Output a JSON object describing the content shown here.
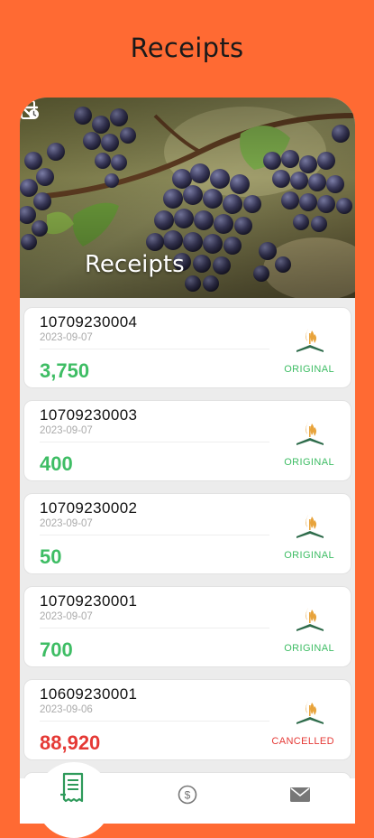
{
  "app": {
    "page_title": "Receipts",
    "accent_color": "#FF6A33",
    "original_color": "#3ebd64",
    "cancelled_color": "#e53935"
  },
  "header": {
    "title": "Receipts",
    "back_icon": "arrow-left-icon",
    "action_icon": "clipboard-clock-icon"
  },
  "receipts": [
    {
      "number": "10709230004",
      "date": "2023-09-07",
      "amount": "3,750",
      "status": "ORIGINAL"
    },
    {
      "number": "10709230003",
      "date": "2023-09-07",
      "amount": "400",
      "status": "ORIGINAL"
    },
    {
      "number": "10709230002",
      "date": "2023-09-07",
      "amount": "50",
      "status": "ORIGINAL"
    },
    {
      "number": "10709230001",
      "date": "2023-09-07",
      "amount": "700",
      "status": "ORIGINAL"
    },
    {
      "number": "10609230001",
      "date": "2023-09-06",
      "amount": "88,920",
      "status": "CANCELLED"
    }
  ],
  "bottom_nav": {
    "items": [
      {
        "icon": "receipt-icon",
        "active": true
      },
      {
        "icon": "dollar-icon",
        "active": false
      },
      {
        "icon": "mail-icon",
        "active": false
      }
    ]
  }
}
